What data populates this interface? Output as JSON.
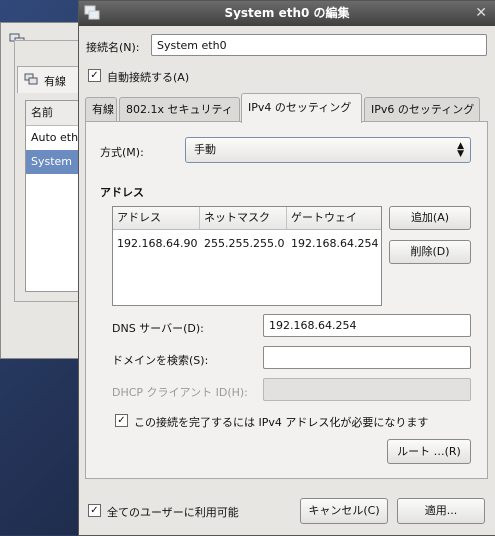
{
  "background_window": {
    "tab_label": "有線",
    "list_header": "名前",
    "rows": [
      "Auto eth",
      "System"
    ]
  },
  "dialog": {
    "title": "System eth0 の編集",
    "close_glyph": "✕",
    "connection_name_label": "接続名(N):",
    "connection_name_value": "System eth0",
    "auto_connect_label": "自動接続する(A)",
    "tabs": [
      "有線",
      "802.1x セキュリティ",
      "IPv4 のセッティング",
      "IPv6 のセッティング"
    ],
    "active_tab": "IPv4 のセッティング",
    "method_label": "方式(M):",
    "method_value": "手動",
    "address_section": "アドレス",
    "address_table": {
      "columns": [
        "アドレス",
        "ネットマスク",
        "ゲートウェイ"
      ],
      "rows": [
        [
          "192.168.64.90",
          "255.255.255.0",
          "192.168.64.254"
        ]
      ]
    },
    "add_button": "追加(A)",
    "delete_button": "削除(D)",
    "dns_label": "DNS サーバー(D):",
    "dns_value": "192.168.64.254",
    "search_domain_label": "ドメインを検索(S):",
    "search_domain_value": "",
    "dhcp_client_label": "DHCP クライアント ID(H):",
    "dhcp_client_value": "",
    "require_ipv4_label": "この接続を完了するには IPv4 アドレス化が必要になります",
    "routes_button": "ルート …(R)",
    "all_users_label": "全てのユーザーに利用可能",
    "cancel_button": "キャンセル(C)",
    "apply_button": "適用...",
    "check_glyph": "✓"
  }
}
